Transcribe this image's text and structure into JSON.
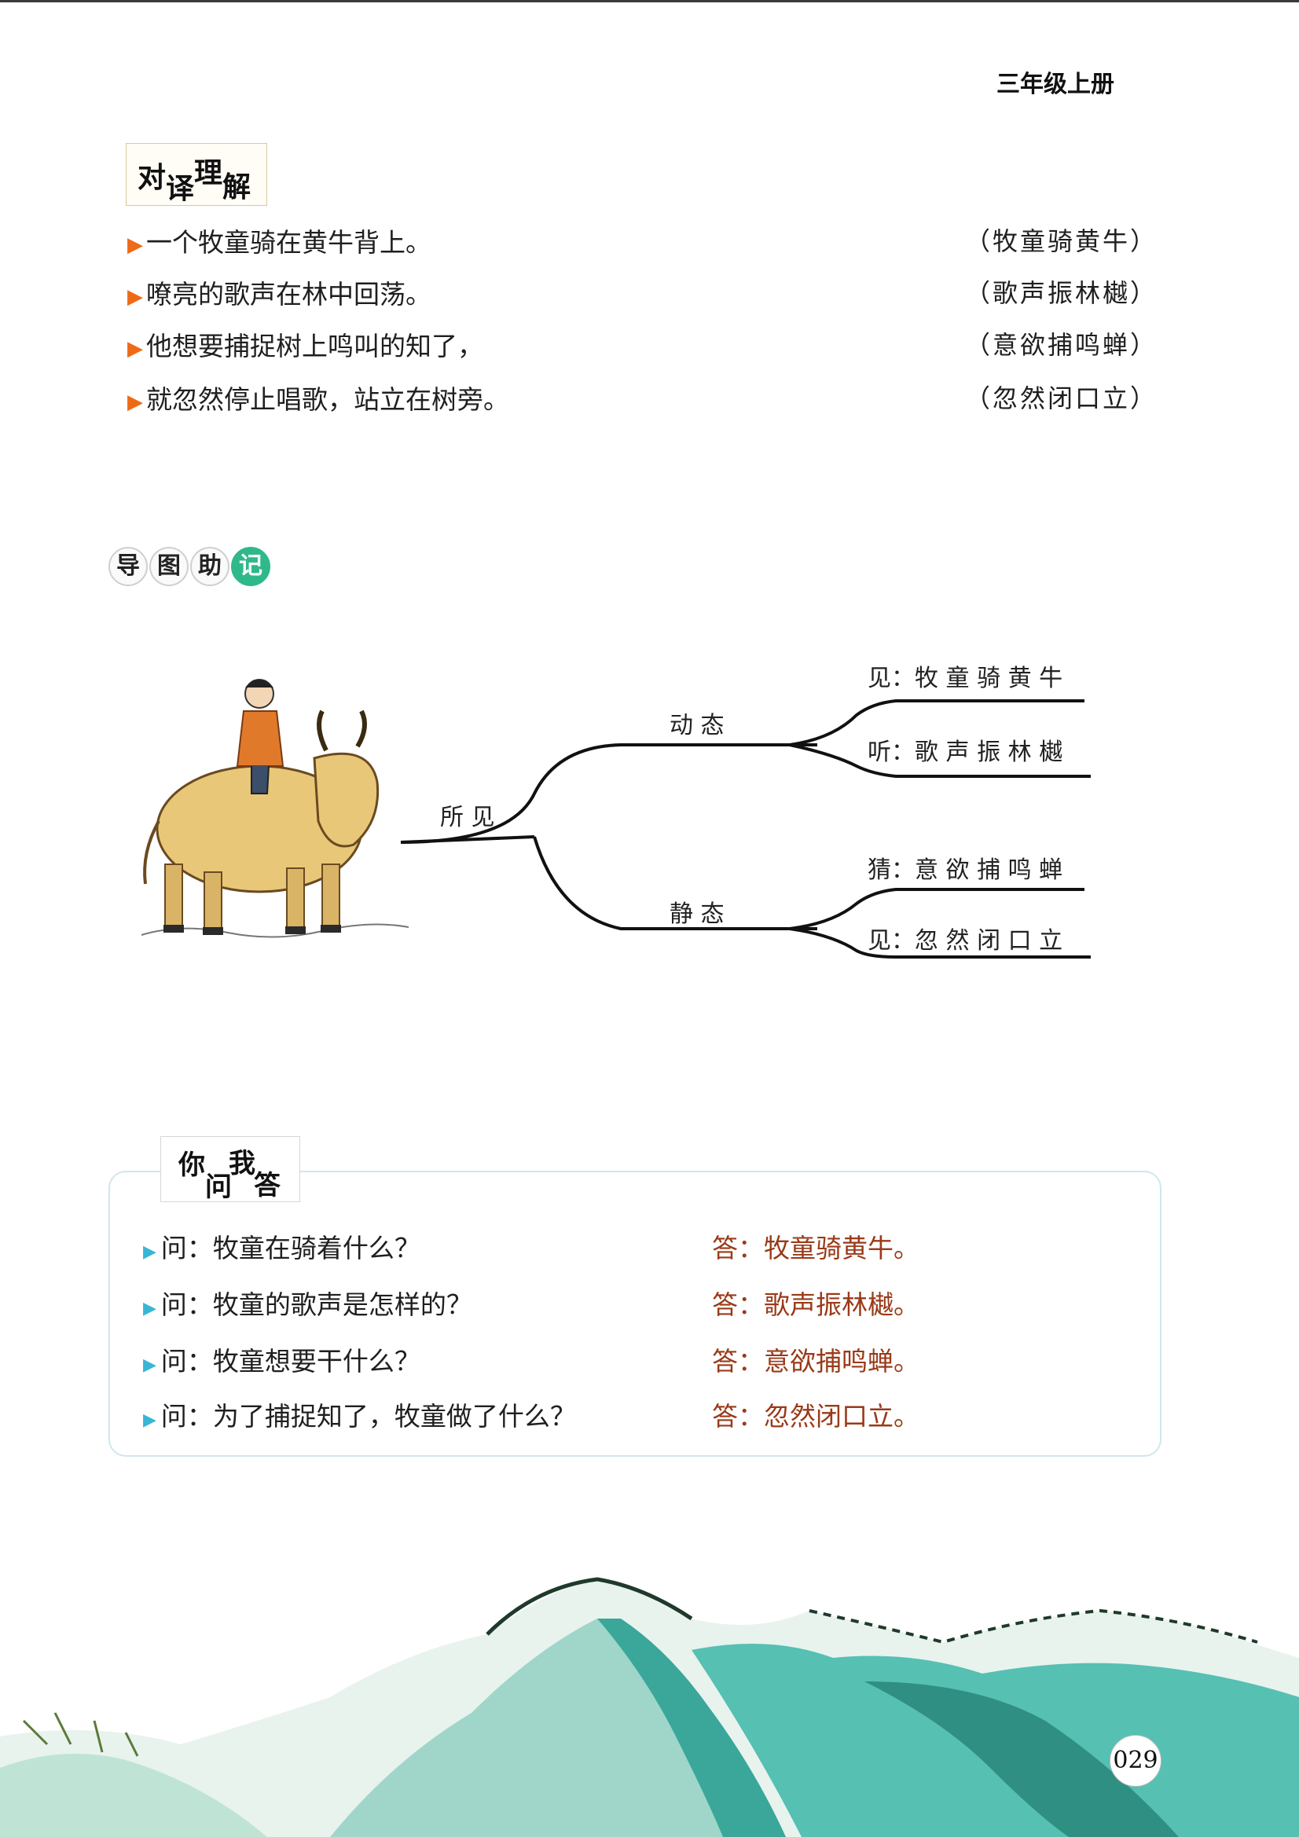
{
  "header": {
    "grade": "三年级上册"
  },
  "translation": {
    "title_chars": [
      "对",
      "译",
      "理",
      "解"
    ],
    "rows": [
      {
        "modern": "一个牧童骑在黄牛背上。",
        "classical": "（牧童骑黄牛）"
      },
      {
        "modern": "嘹亮的歌声在林中回荡。",
        "classical": "（歌声振林樾）"
      },
      {
        "modern": "他想要捕捉树上鸣叫的知了，",
        "classical": "（意欲捕鸣蝉）"
      },
      {
        "modern": "就忽然停止唱歌，站立在树旁。",
        "classical": "（忽然闭口立）"
      }
    ]
  },
  "mindmap": {
    "title_chars": [
      "导",
      "图",
      "助",
      "记"
    ],
    "root": "所 见",
    "branch_top": "动 态",
    "branch_bottom": "静 态",
    "leaves": [
      "见：牧 童 骑 黄 牛",
      "听：歌 声 振 林 樾",
      "猜：意 欲 捕 鸣 蝉",
      "见：忽 然 闭 口 立"
    ]
  },
  "qa": {
    "title_chars": [
      "你",
      "问",
      "我",
      "答"
    ],
    "items": [
      {
        "q": "问：牧童在骑着什么？",
        "a": "答：牧童骑黄牛。"
      },
      {
        "q": "问：牧童的歌声是怎样的？",
        "a": "答：歌声振林樾。"
      },
      {
        "q": "问：牧童想要干什么？",
        "a": "答：意欲捕鸣蝉。"
      },
      {
        "q": "问：为了捕捉知了，牧童做了什么？",
        "a": "答：忽然闭口立。"
      }
    ]
  },
  "footer": {
    "page_number": "029"
  },
  "colors": {
    "accent_orange": "#ef6a16",
    "accent_cyan": "#39b6d6",
    "answer_brown": "#9a3a18",
    "badge_green": "#2fb98a"
  }
}
